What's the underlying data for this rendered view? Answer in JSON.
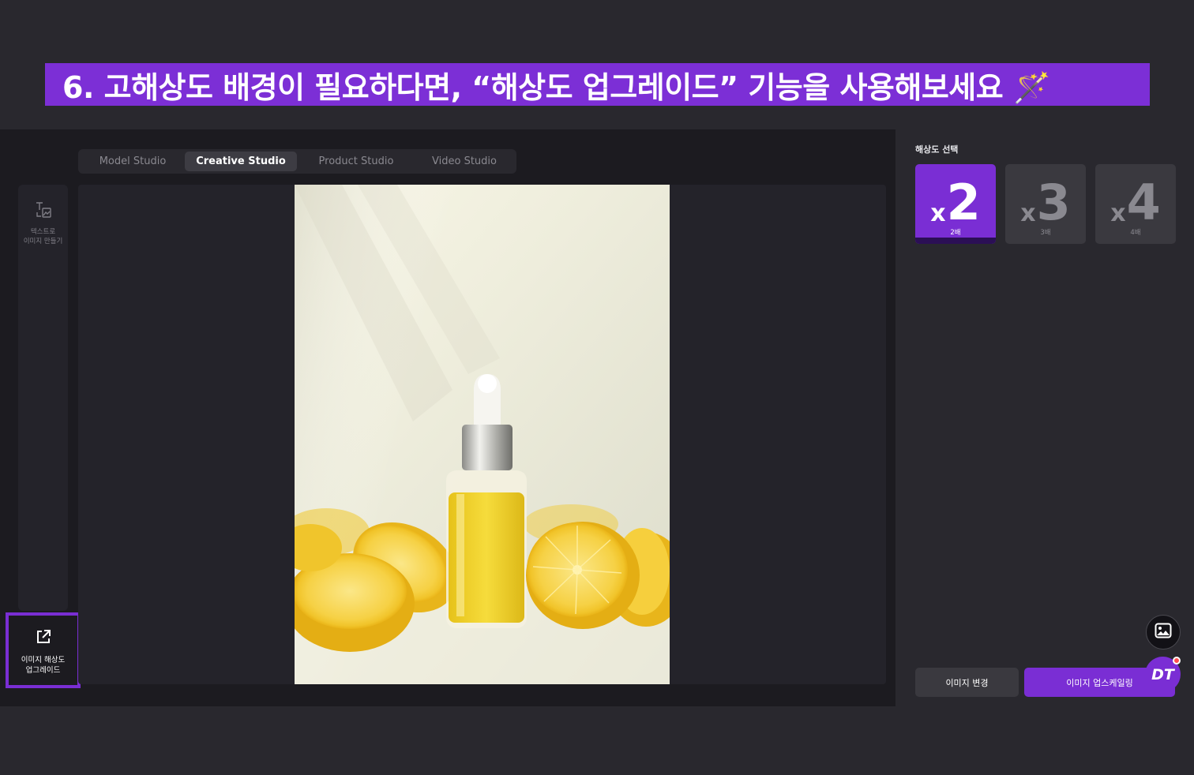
{
  "banner": {
    "text": "6. 고해상도 배경이 필요하다면, “해상도 업그레이드” 기능을 사용해보세요 🪄"
  },
  "tabs": [
    {
      "label": "Model Studio",
      "active": false
    },
    {
      "label": "Creative Studio",
      "active": true
    },
    {
      "label": "Product Studio",
      "active": false
    },
    {
      "label": "Video Studio",
      "active": false
    }
  ],
  "sidebar": {
    "text_to_image": {
      "line1": "텍스트로",
      "line2": "이미지 만들기"
    },
    "upscale": {
      "line1": "이미지 해상도",
      "line2": "업그레이드"
    }
  },
  "right_panel": {
    "title": "해상도 선택",
    "options": [
      {
        "x": "x",
        "n": "2",
        "label": "2배",
        "selected": true
      },
      {
        "x": "x",
        "n": "3",
        "label": "3배",
        "selected": false
      },
      {
        "x": "x",
        "n": "4",
        "label": "4배",
        "selected": false
      }
    ],
    "change_button": "이미지 변경",
    "upscale_button": "이미지 업스케일링"
  },
  "floating": {
    "dt_label": "DT"
  },
  "colors": {
    "accent": "#7a2ed4",
    "background": "#1c1b20",
    "panel": "#29282e"
  },
  "icons": [
    "text-image-icon",
    "external-link-icon",
    "image-icon"
  ]
}
